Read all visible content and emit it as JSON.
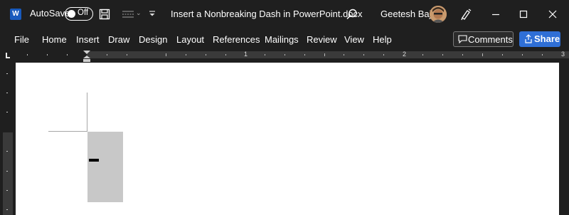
{
  "titlebar": {
    "app_icon": "word-icon",
    "app_letter": "W",
    "autosave_label": "AutoSave",
    "autosave_state": "Off",
    "doc_title": "Insert a Nonbreaking Dash in PowerPoint.docx",
    "user_name": "Geetesh Bajaj"
  },
  "menu": {
    "items": [
      "File",
      "Home",
      "Insert",
      "Draw",
      "Design",
      "Layout",
      "References",
      "Mailings",
      "Review",
      "View",
      "Help"
    ],
    "comments_label": "Comments",
    "share_label": "Share"
  },
  "ruler": {
    "numbers": [
      "1",
      "2",
      "3"
    ]
  },
  "colors": {
    "background": "#1f1f1f",
    "share_blue": "#2f6fd6",
    "word_blue": "#185abd",
    "selection_gray": "#c8c8c8"
  }
}
